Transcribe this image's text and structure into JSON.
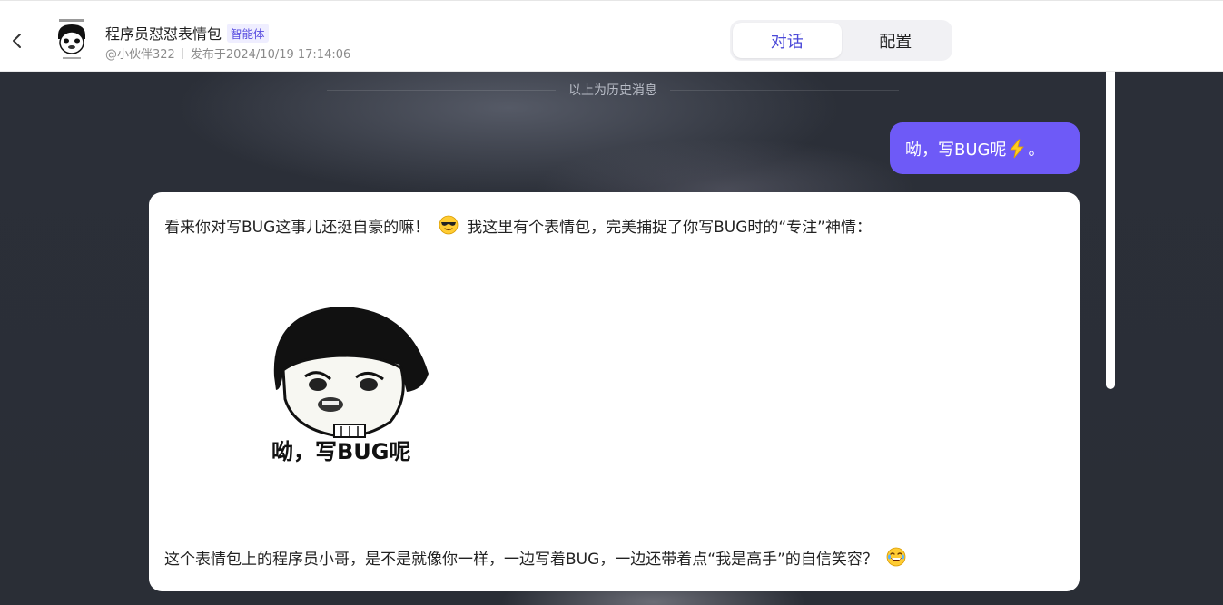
{
  "header": {
    "back_icon": "chevron-left-icon",
    "title": "程序员怼怼表情包",
    "badge": "智能体",
    "author": "@小伙伴322",
    "published": "发布于2024/10/19 17:14:06",
    "tabs": [
      {
        "label": "对话",
        "active": true
      },
      {
        "label": "配置",
        "active": false
      }
    ]
  },
  "chat": {
    "history_divider": "以上为历史消息",
    "user_message": {
      "text_before": "呦，写BUG呢",
      "emoji": "lightning-icon",
      "text_after": "。"
    },
    "bot_message": {
      "line1_before": "看来你对写BUG这事儿还挺自豪的嘛！",
      "line1_emoji": "sunglasses-emoji",
      "line1_after": "我这里有个表情包，完美捕捉了你写BUG时的“专注”神情：",
      "meme_caption": "呦，写BUG呢",
      "line2": "这个表情包上的程序员小哥，是不是就像你一样，一边写着BUG，一边还带着点“我是高手”的自信笑容？",
      "line2_emoji": "laughing-emoji"
    }
  },
  "colors": {
    "accent": "#6e5af7",
    "tab_active": "#4b49d8",
    "chat_bg": "#2b2f38"
  }
}
